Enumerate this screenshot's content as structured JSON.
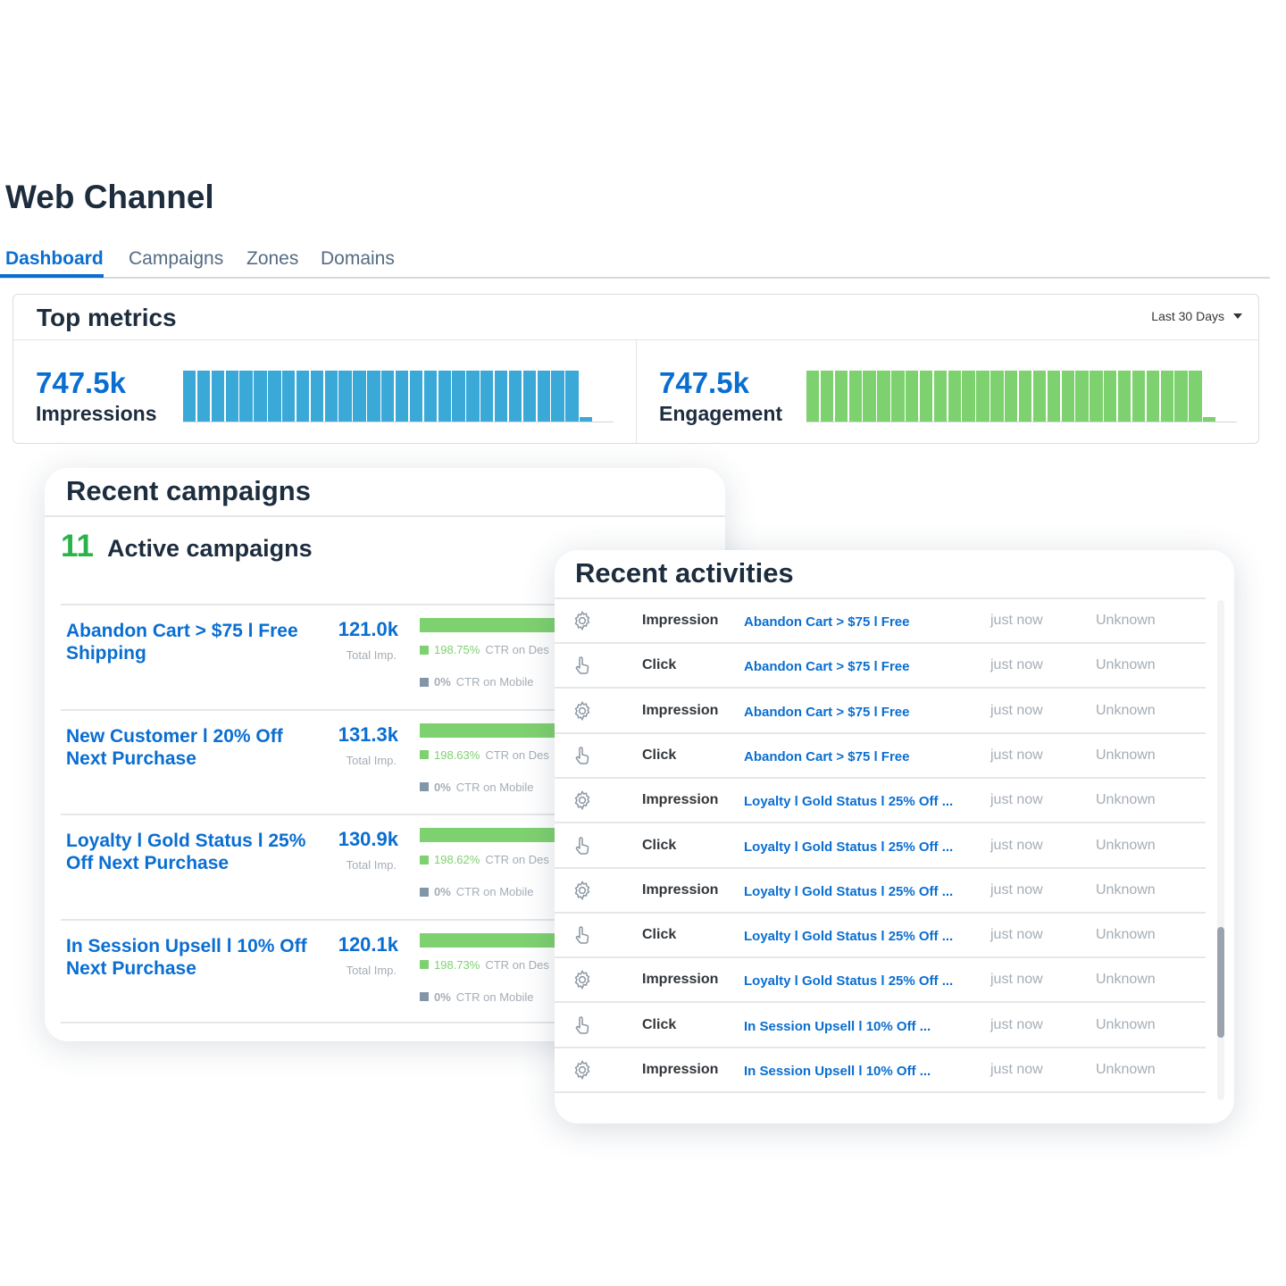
{
  "page": {
    "title": "Web Channel"
  },
  "tabs": [
    {
      "label": "Dashboard",
      "active": true
    },
    {
      "label": "Campaigns",
      "active": false
    },
    {
      "label": "Zones",
      "active": false
    },
    {
      "label": "Domains",
      "active": false
    }
  ],
  "top_metrics": {
    "title": "Top metrics",
    "range": "Last 30 Days",
    "impressions": {
      "value": "747.5k",
      "label": "Impressions",
      "color": "#3aa9d8"
    },
    "engagement": {
      "value": "747.5k",
      "label": "Engagement",
      "color": "#7ed16f"
    }
  },
  "chart_data": [
    {
      "type": "bar",
      "series": [
        {
          "values": [
            1,
            1,
            1,
            1,
            1,
            1,
            1,
            1,
            1,
            1,
            1,
            1,
            1,
            1,
            1,
            1,
            1,
            1,
            1,
            1,
            1,
            1,
            1,
            1,
            1,
            1,
            1,
            1,
            0.1
          ]
        }
      ],
      "title": "",
      "xlabel": "",
      "ylabel": ""
    },
    {
      "type": "bar",
      "series": [
        {
          "values": [
            1,
            1,
            1,
            1,
            1,
            1,
            1,
            1,
            1,
            1,
            1,
            1,
            1,
            1,
            1,
            1,
            1,
            1,
            1,
            1,
            1,
            1,
            1,
            1,
            1,
            1,
            1,
            1,
            0.1
          ]
        }
      ],
      "title": "",
      "xlabel": "",
      "ylabel": ""
    }
  ],
  "recent_campaigns": {
    "title": "Recent campaigns",
    "active_count": "11",
    "active_label": "Active campaigns",
    "items": [
      {
        "name": "Abandon Cart > $75 l Free Shipping",
        "total": "121.0k",
        "total_label": "Total Imp.",
        "desktop_pct": "198.75%",
        "desktop_label": "CTR on Des",
        "mobile_pct": "0%",
        "mobile_label": "CTR on Mobile"
      },
      {
        "name": "New Customer l 20% Off Next Purchase",
        "total": "131.3k",
        "total_label": "Total Imp.",
        "desktop_pct": "198.63%",
        "desktop_label": "CTR on Des",
        "mobile_pct": "0%",
        "mobile_label": "CTR on Mobile"
      },
      {
        "name": "Loyalty l Gold Status l 25% Off Next Purchase",
        "total": "130.9k",
        "total_label": "Total Imp.",
        "desktop_pct": "198.62%",
        "desktop_label": "CTR on Des",
        "mobile_pct": "0%",
        "mobile_label": "CTR on Mobile"
      },
      {
        "name": "In Session Upsell l 10% Off Next Purchase",
        "total": "120.1k",
        "total_label": "Total Imp.",
        "desktop_pct": "198.73%",
        "desktop_label": "CTR on Des",
        "mobile_pct": "0%",
        "mobile_label": "CTR on Mobile"
      }
    ],
    "colors": {
      "desktop": "#7ed16f",
      "mobile": "#8396a8"
    }
  },
  "recent_activities": {
    "title": "Recent activities",
    "rows": [
      {
        "icon": "gear-icon",
        "type": "Impression",
        "campaign": "Abandon Cart > $75 l Free",
        "time": "just now",
        "source": "Unknown"
      },
      {
        "icon": "pointer-hand-icon",
        "type": "Click",
        "campaign": "Abandon Cart > $75 l Free",
        "time": "just now",
        "source": "Unknown"
      },
      {
        "icon": "gear-icon",
        "type": "Impression",
        "campaign": "Abandon Cart > $75 l Free",
        "time": "just now",
        "source": "Unknown"
      },
      {
        "icon": "pointer-hand-icon",
        "type": "Click",
        "campaign": "Abandon Cart > $75 l Free",
        "time": "just now",
        "source": "Unknown"
      },
      {
        "icon": "gear-icon",
        "type": "Impression",
        "campaign": "Loyalty l Gold Status l 25% Off ...",
        "time": "just now",
        "source": "Unknown"
      },
      {
        "icon": "pointer-hand-icon",
        "type": "Click",
        "campaign": "Loyalty l Gold Status l 25% Off ...",
        "time": "just now",
        "source": "Unknown"
      },
      {
        "icon": "gear-icon",
        "type": "Impression",
        "campaign": "Loyalty l Gold Status l 25% Off ...",
        "time": "just now",
        "source": "Unknown"
      },
      {
        "icon": "pointer-hand-icon",
        "type": "Click",
        "campaign": "Loyalty l Gold Status l 25% Off ...",
        "time": "just now",
        "source": "Unknown"
      },
      {
        "icon": "gear-icon",
        "type": "Impression",
        "campaign": "Loyalty l Gold Status l 25% Off ...",
        "time": "just now",
        "source": "Unknown"
      },
      {
        "icon": "pointer-hand-icon",
        "type": "Click",
        "campaign": "In Session Upsell l 10% Off ...",
        "time": "just now",
        "source": "Unknown"
      },
      {
        "icon": "gear-icon",
        "type": "Impression",
        "campaign": "In Session Upsell l 10% Off ...",
        "time": "just now",
        "source": "Unknown"
      }
    ]
  }
}
